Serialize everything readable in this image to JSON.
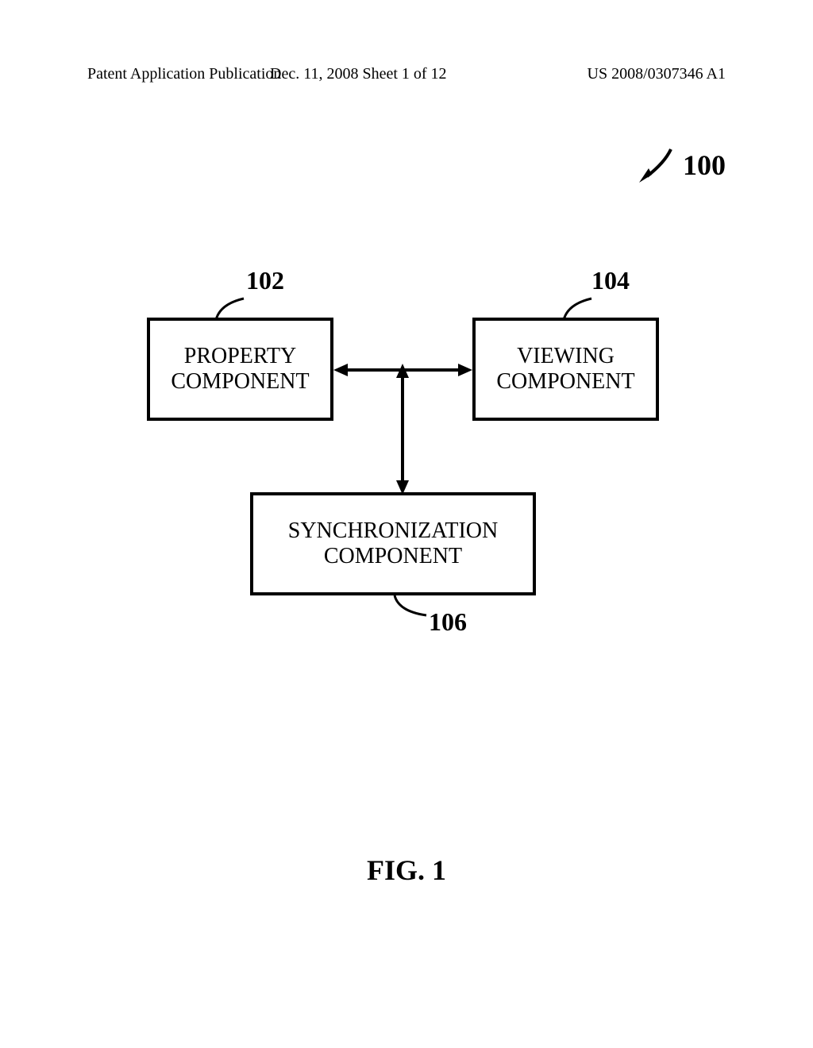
{
  "header": {
    "publication_type": "Patent Application Publication",
    "date_sheet": "Dec. 11, 2008  Sheet 1 of 12",
    "patent_number": "US 2008/0307346 A1"
  },
  "diagram": {
    "system_ref": "100",
    "boxes": {
      "property": {
        "line1": "PROPERTY",
        "line2": "COMPONENT",
        "ref": "102"
      },
      "viewing": {
        "line1": "VIEWING",
        "line2": "COMPONENT",
        "ref": "104"
      },
      "sync": {
        "line1": "SYNCHRONIZATION",
        "line2": "COMPONENT",
        "ref": "106"
      }
    }
  },
  "figure_label": "FIG. 1"
}
